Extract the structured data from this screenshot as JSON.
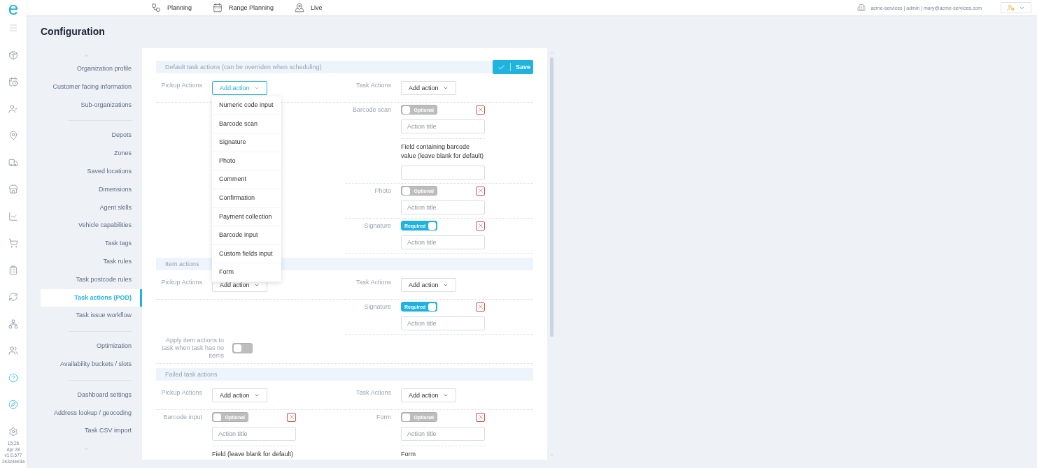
{
  "logo": "e",
  "rail": [
    {
      "kind": "menu",
      "highlighted": false
    },
    {
      "kind": "box",
      "highlighted": false
    },
    {
      "kind": "calendar",
      "highlighted": false
    },
    {
      "kind": "user",
      "highlighted": false
    },
    {
      "kind": "pin",
      "highlighted": false
    },
    {
      "kind": "truck",
      "highlighted": false
    },
    {
      "kind": "store",
      "highlighted": false
    },
    {
      "kind": "chart",
      "highlighted": false
    },
    {
      "kind": "dolly",
      "highlighted": false
    },
    {
      "kind": "checklist",
      "highlighted": false
    },
    {
      "kind": "refresh",
      "highlighted": false
    },
    {
      "kind": "network",
      "highlighted": false
    },
    {
      "kind": "users",
      "highlighted": false
    },
    {
      "kind": "help",
      "highlighted": true
    },
    {
      "kind": "compass",
      "highlighted": true
    },
    {
      "kind": "settings",
      "highlighted": false
    }
  ],
  "build_info": [
    "15:26",
    "Apr 28",
    "v1.0.577",
    "2e3c4ee3a"
  ],
  "top_nav": [
    {
      "kind": "workflow",
      "label": "Planning"
    },
    {
      "kind": "calendar",
      "label": "Range Planning"
    },
    {
      "kind": "map",
      "label": "Live"
    }
  ],
  "account_line": "acme-services | admin | mary@acme-services.com",
  "page_title": "Configuration",
  "nav_groups": [
    [
      {
        "label": "Organization profile",
        "selected": false
      },
      {
        "label": "Customer facing information",
        "selected": false
      },
      {
        "label": "Sub-organizations",
        "selected": false
      }
    ],
    [
      {
        "label": "Depots",
        "selected": false
      },
      {
        "label": "Zones",
        "selected": false
      },
      {
        "label": "Saved locations",
        "selected": false
      },
      {
        "label": "Dimensions",
        "selected": false
      },
      {
        "label": "Agent skills",
        "selected": false
      },
      {
        "label": "Vehicle capabilities",
        "selected": false
      },
      {
        "label": "Task tags",
        "selected": false
      },
      {
        "label": "Task rules",
        "selected": false
      },
      {
        "label": "Task postcode rules",
        "selected": false
      },
      {
        "label": "Task actions (POD)",
        "selected": true
      },
      {
        "label": "Task issue workflow",
        "selected": false
      }
    ],
    [
      {
        "label": "Optimization",
        "selected": false
      },
      {
        "label": "Availability buckets / slots",
        "selected": false
      }
    ],
    [
      {
        "label": "Dashboard settings",
        "selected": false
      },
      {
        "label": "Address lookup / geocoding",
        "selected": false
      },
      {
        "label": "Task CSV import",
        "selected": false
      }
    ]
  ],
  "save_button": "Save",
  "menu_items": [
    "Numeric code input",
    "Barcode scan",
    "Signature",
    "Photo",
    "Comment",
    "Confirmation",
    "Payment collection",
    "Barcode input",
    "Custom fields input",
    "Form"
  ],
  "sections": [
    {
      "title": "Default task actions (can be overriden when scheduling)",
      "columns": [
        {
          "label": "Pickup Actions",
          "button": "Add action",
          "menu_open": true
        },
        {
          "label": "Task Actions",
          "button": "Add action",
          "menu_open": false,
          "actions": [
            {
              "name": "Barcode scan",
              "required": false,
              "toggle_label": "Optional",
              "placeholder": "Action title",
              "extra_label": "Field containing barcode value (leave blank for default)"
            },
            {
              "name": "Photo",
              "required": false,
              "toggle_label": "Optional",
              "placeholder": "Action title"
            },
            {
              "name": "Signature",
              "required": true,
              "toggle_label": "Required",
              "placeholder": "Action title"
            }
          ]
        }
      ]
    },
    {
      "title": "Item actions",
      "columns": [
        {
          "label": "Pickup Actions",
          "button": "Add action",
          "menu_open": false
        },
        {
          "label": "Task Actions",
          "button": "Add action",
          "menu_open": false,
          "actions": [
            {
              "name": "Signature",
              "required": true,
              "toggle_label": "Required",
              "placeholder": "Action title"
            }
          ]
        }
      ],
      "apply_toggle": {
        "label": "Apply item actions to task when task has no items",
        "on": false
      }
    },
    {
      "title": "Failed task actions",
      "columns": [
        {
          "label": "Pickup Actions",
          "button": "Add action",
          "menu_open": false,
          "actions": [
            {
              "name": "Barcode input",
              "required": false,
              "toggle_label": "Optional",
              "placeholder": "Action title",
              "extra_label": "Field (leave blank for default)"
            }
          ]
        },
        {
          "label": "Task Actions",
          "button": "Add action",
          "menu_open": false,
          "actions": [
            {
              "name": "Form",
              "required": false,
              "toggle_label": "Optional",
              "placeholder": "Action title",
              "extra_label": "Form"
            }
          ]
        }
      ]
    }
  ]
}
